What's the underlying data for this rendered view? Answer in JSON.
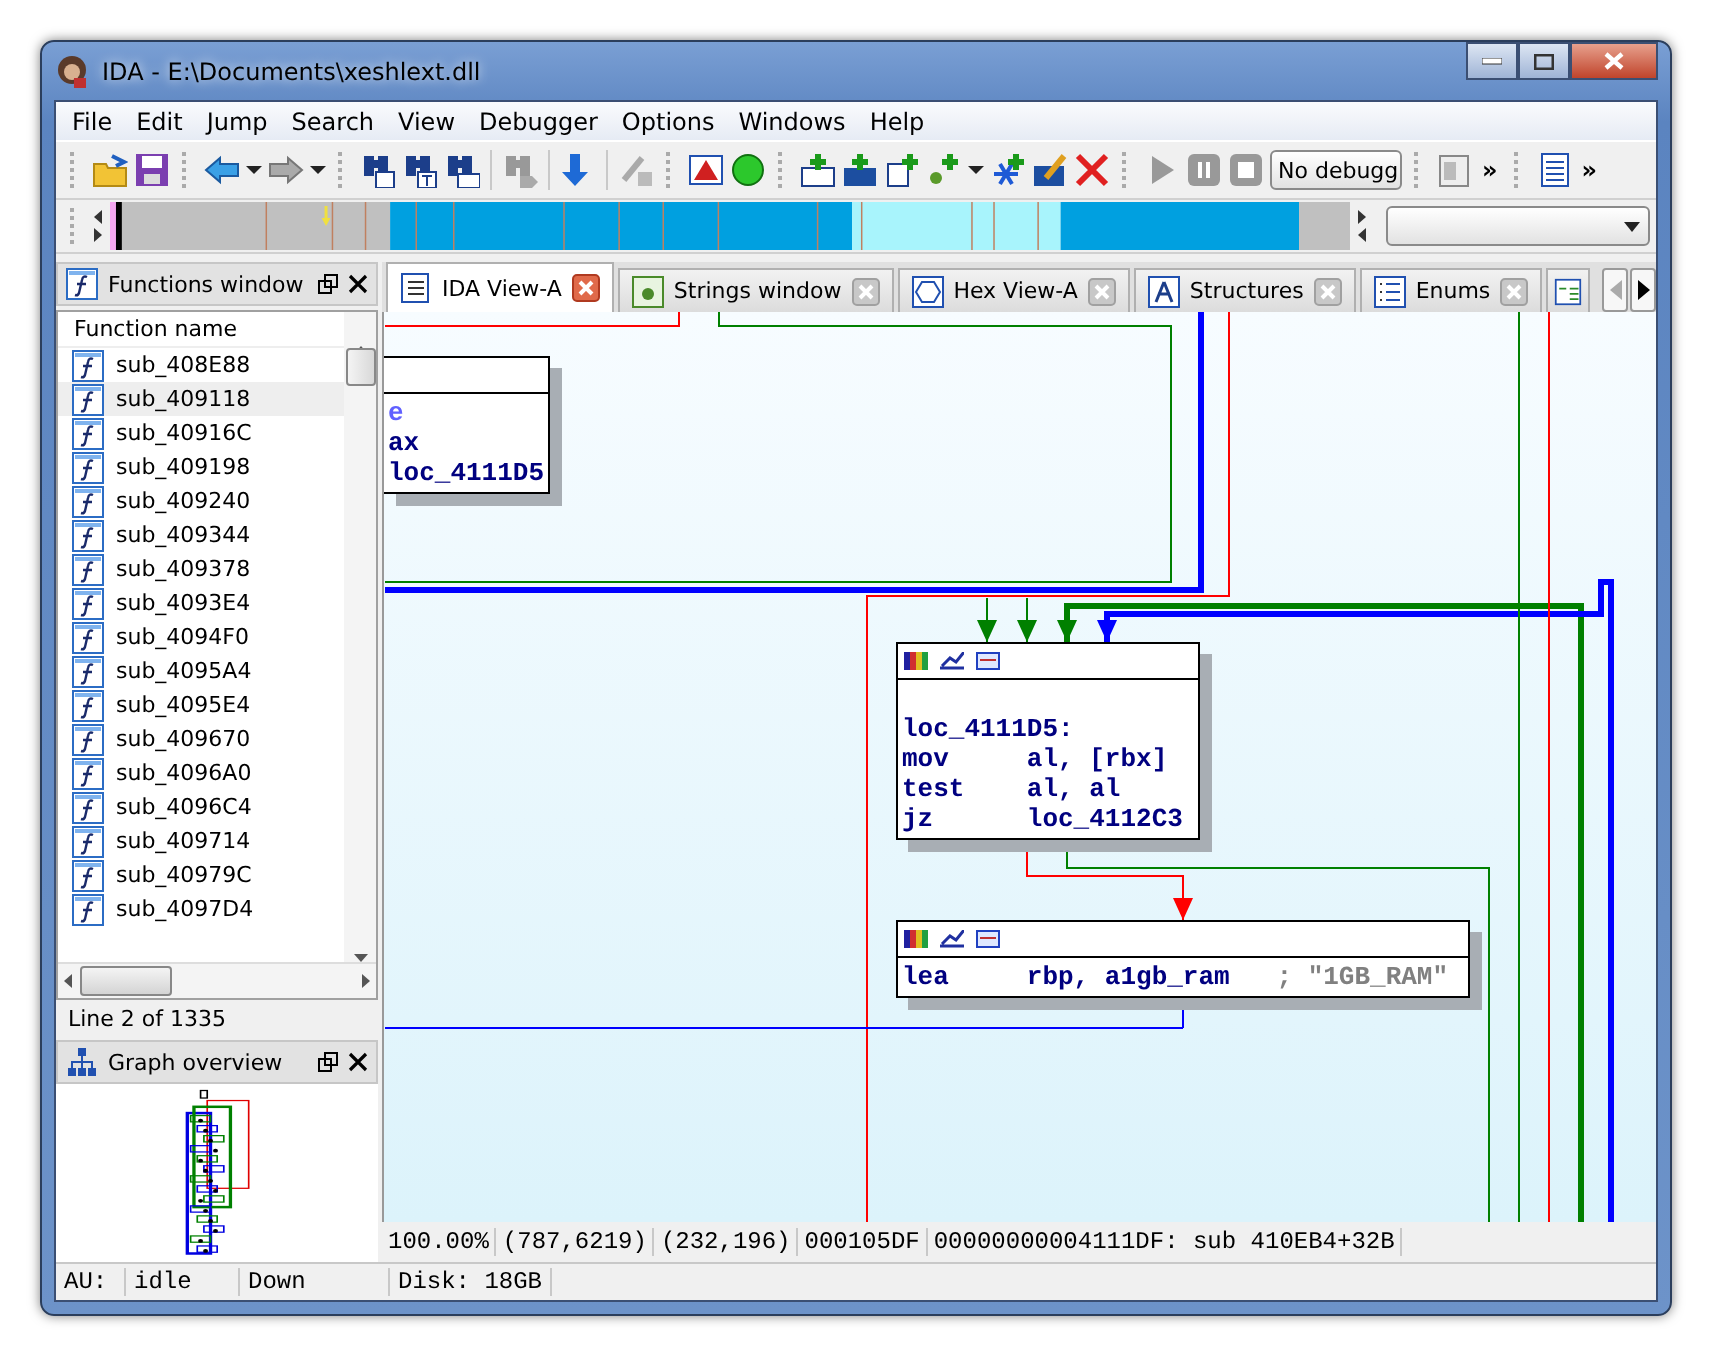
{
  "window": {
    "title": "IDA - E:\\Documents\\xeshlext.dll"
  },
  "menu": [
    {
      "label": "File"
    },
    {
      "label": "Edit"
    },
    {
      "label": "Jump"
    },
    {
      "label": "Search"
    },
    {
      "label": "View"
    },
    {
      "label": "Debugger"
    },
    {
      "label": "Options"
    },
    {
      "label": "Windows"
    },
    {
      "label": "Help"
    }
  ],
  "toolbar": {
    "debugger_select": {
      "value": "No debugg"
    },
    "overflow_buttons": [
      "»",
      "»"
    ]
  },
  "functions_window": {
    "title": "Functions window",
    "column": "Function name",
    "rows": [
      {
        "name": "sub_408E88",
        "selected": false
      },
      {
        "name": "sub_409118",
        "selected": true
      },
      {
        "name": "sub_40916C",
        "selected": false
      },
      {
        "name": "sub_409198",
        "selected": false
      },
      {
        "name": "sub_409240",
        "selected": false
      },
      {
        "name": "sub_409344",
        "selected": false
      },
      {
        "name": "sub_409378",
        "selected": false
      },
      {
        "name": "sub_4093E4",
        "selected": false
      },
      {
        "name": "sub_4094F0",
        "selected": false
      },
      {
        "name": "sub_4095A4",
        "selected": false
      },
      {
        "name": "sub_4095E4",
        "selected": false
      },
      {
        "name": "sub_409670",
        "selected": false
      },
      {
        "name": "sub_4096A0",
        "selected": false
      },
      {
        "name": "sub_4096C4",
        "selected": false
      },
      {
        "name": "sub_409714",
        "selected": false
      },
      {
        "name": "sub_40979C",
        "selected": false
      },
      {
        "name": "sub_4097D4",
        "selected": false
      }
    ],
    "status": "Line 2 of 1335"
  },
  "graph_overview": {
    "title": "Graph overview"
  },
  "tabs": [
    {
      "label": "IDA View-A",
      "kind": "listing",
      "selected": true
    },
    {
      "label": "Strings window",
      "kind": "strings",
      "selected": false
    },
    {
      "label": "Hex View-A",
      "kind": "hex",
      "selected": false
    },
    {
      "label": "Structures",
      "kind": "structures",
      "selected": false
    },
    {
      "label": "Enums",
      "kind": "enums",
      "selected": false
    },
    {
      "kind": "partial",
      "selected": false
    }
  ],
  "graph": {
    "nodes": [
      {
        "kind": "partial",
        "lines": [
          {
            "kind": "reference",
            "text": "e"
          },
          {
            "kind": "fragment",
            "text": "ax"
          },
          {
            "kind": "fragment",
            "text": "loc_4111D5"
          }
        ]
      },
      {
        "kind": "block",
        "lines": [
          {
            "kind": "label",
            "text": "loc_4111D5:"
          },
          {
            "kind": "instruction",
            "mnemonic": "mov",
            "operands": "al, [rbx]"
          },
          {
            "kind": "instruction",
            "mnemonic": "test",
            "operands": "al, al"
          },
          {
            "kind": "instruction",
            "mnemonic": "jz",
            "operands": "loc_4112C3"
          }
        ]
      },
      {
        "kind": "block",
        "lines": [
          {
            "kind": "instruction",
            "mnemonic": "lea",
            "operands": "rbp, a1gb_ram",
            "comment": "; \"1GB_RAM\""
          }
        ]
      }
    ]
  },
  "info_bar": [
    "100.00%",
    "(787,6219)",
    "(232,196)",
    "000105DF",
    "00000000004111DF: sub 410EB4+32B"
  ],
  "status_bar": [
    "AU:",
    "idle",
    "Down",
    "Disk: 18GB"
  ]
}
